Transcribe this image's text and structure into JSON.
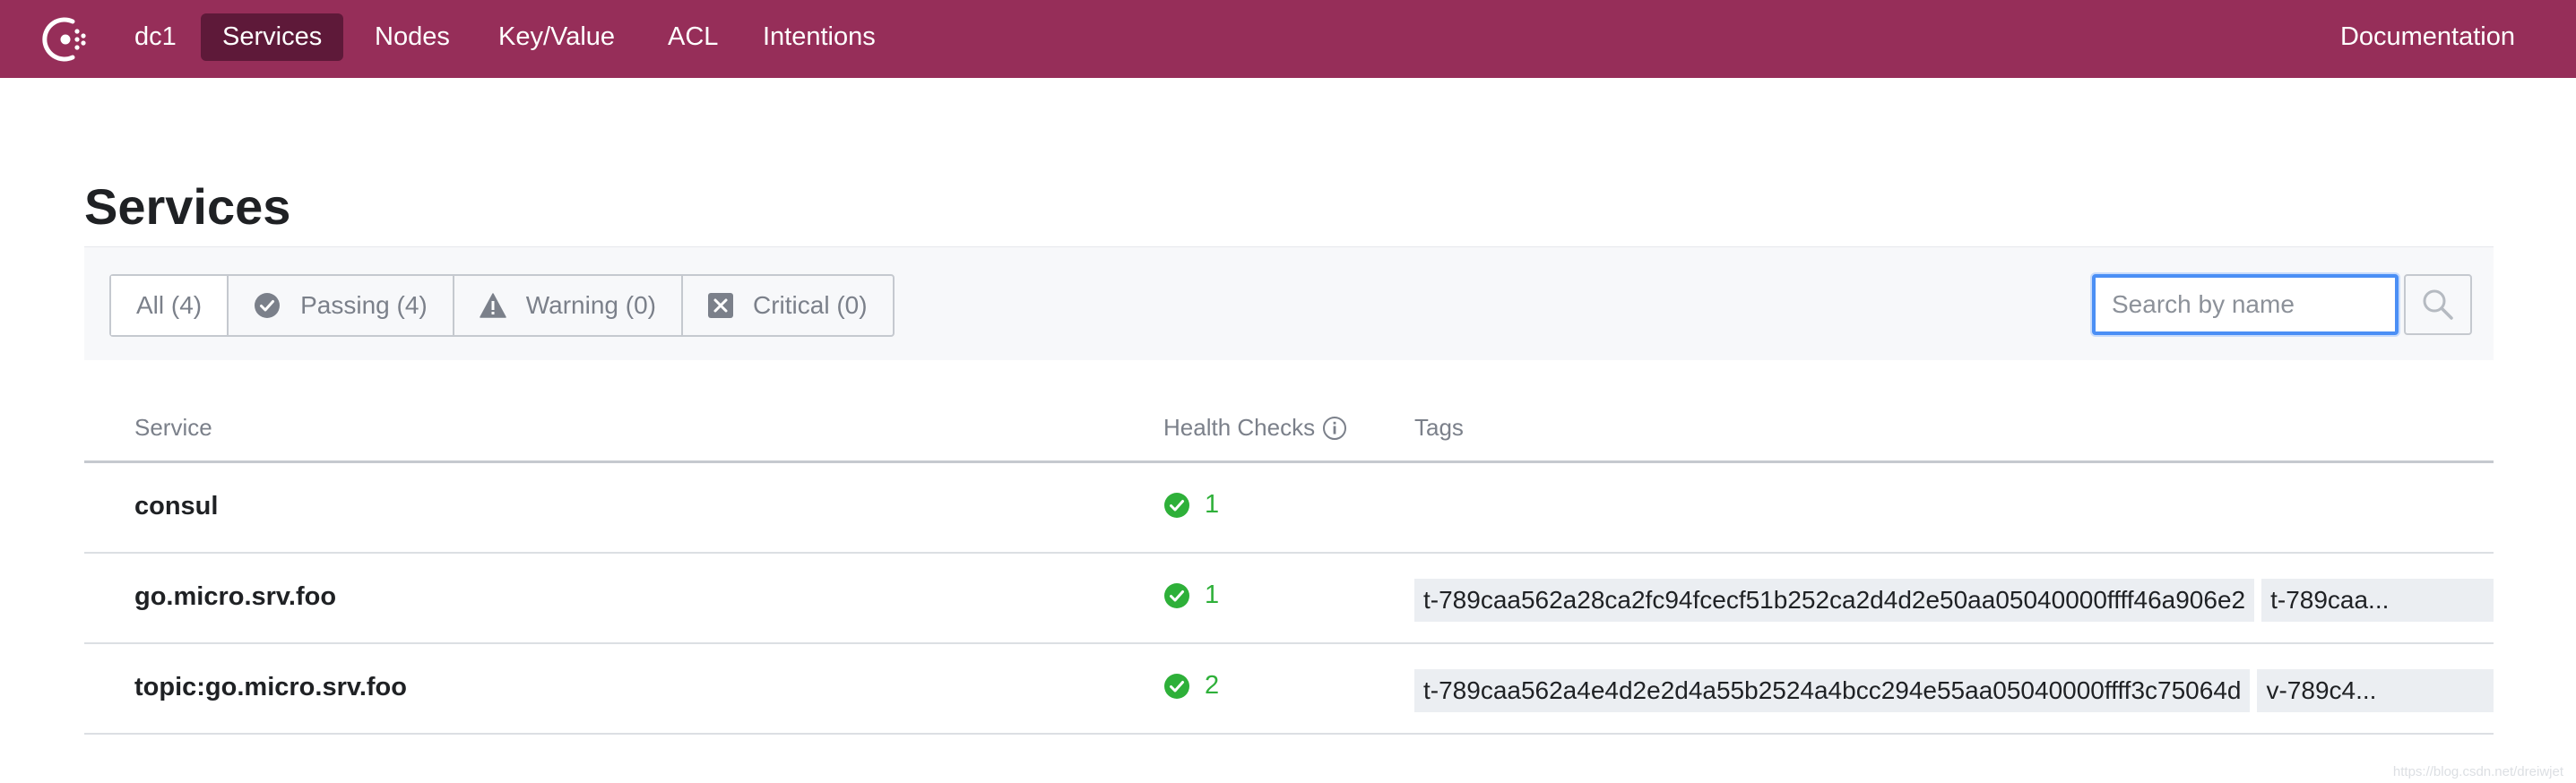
{
  "nav": {
    "datacenter": "dc1",
    "items": [
      {
        "label": "Services",
        "active": true
      },
      {
        "label": "Nodes",
        "active": false
      },
      {
        "label": "Key/Value",
        "active": false
      },
      {
        "label": "ACL",
        "active": false
      },
      {
        "label": "Intentions",
        "active": false
      }
    ],
    "documentation": "Documentation"
  },
  "page": {
    "title": "Services"
  },
  "filters": [
    {
      "label": "All (4)",
      "icon": null,
      "active": true
    },
    {
      "label": "Passing (4)",
      "icon": "check-circle-icon",
      "active": false
    },
    {
      "label": "Warning (0)",
      "icon": "warning-triangle-icon",
      "active": false
    },
    {
      "label": "Critical (0)",
      "icon": "critical-x-icon",
      "active": false
    }
  ],
  "search": {
    "placeholder": "Search by name",
    "value": ""
  },
  "table": {
    "headers": {
      "service": "Service",
      "health": "Health Checks",
      "tags": "Tags"
    },
    "rows": [
      {
        "name": "consul",
        "checks": "1",
        "tags": []
      },
      {
        "name": "go.micro.srv.foo",
        "checks": "1",
        "tags": [
          "t-789caa562a28ca2fc94fcecf51b252ca2d4d2e50aa05040000ffff46a906e2",
          "t-789caa..."
        ]
      },
      {
        "name": "topic:go.micro.srv.foo",
        "checks": "2",
        "tags": [
          "t-789caa562a4e4d2e2d4a55b2524a4bcc294e55aa05040000ffff3c75064d",
          "v-789c4..."
        ]
      }
    ]
  },
  "colors": {
    "brand": "#962e59",
    "brand_active": "#5e1939",
    "passing": "#2eb039",
    "focus": "#4b8ff5"
  },
  "watermark": "https://blog.csdn.net/dreiwjet"
}
